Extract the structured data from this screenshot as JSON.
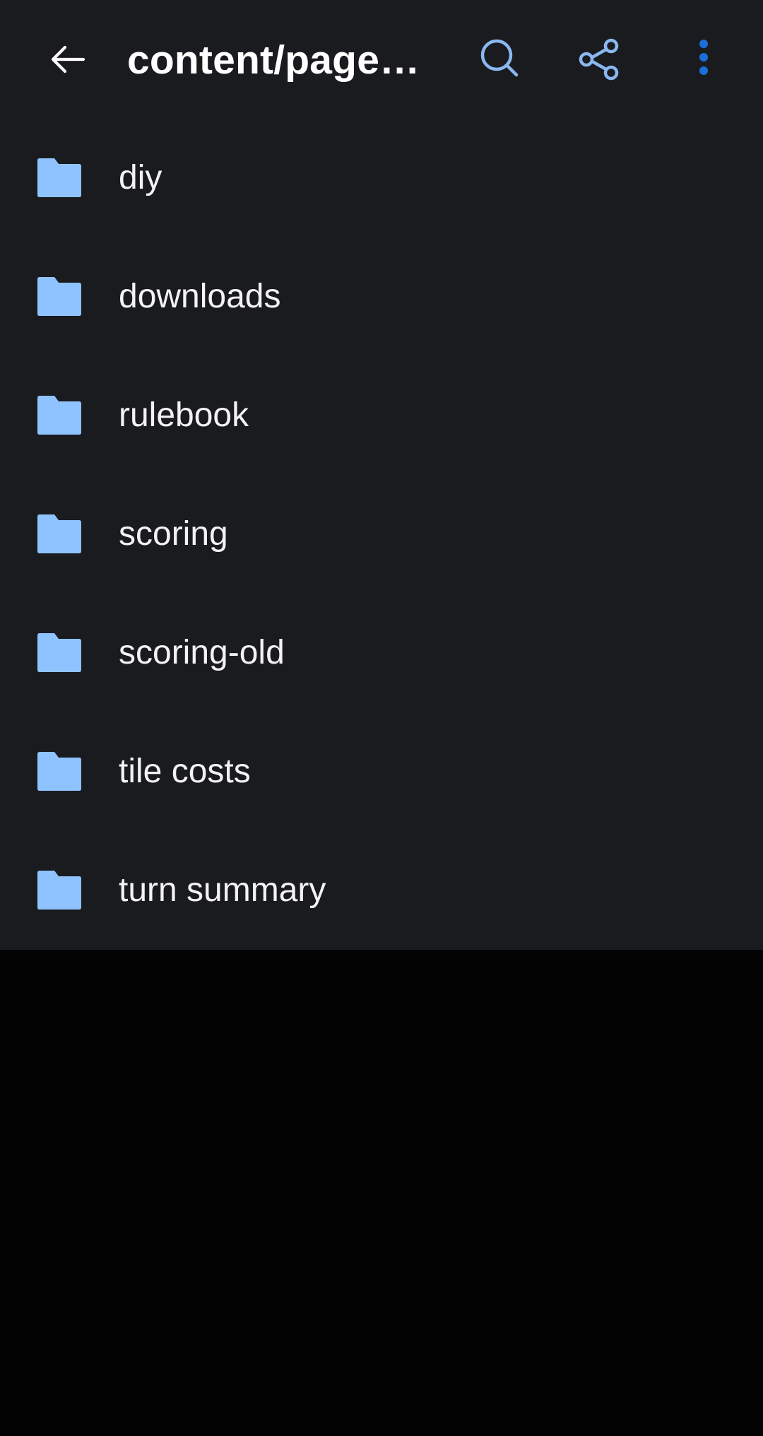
{
  "toolbar": {
    "title": "content/page…",
    "back_icon": "arrow-back-icon",
    "search_icon": "search-icon",
    "share_icon": "share-icon",
    "more_icon": "more-vert-icon"
  },
  "folders": [
    {
      "name": "diy",
      "icon": "folder-icon"
    },
    {
      "name": "downloads",
      "icon": "folder-icon"
    },
    {
      "name": "rulebook",
      "icon": "folder-icon"
    },
    {
      "name": "scoring",
      "icon": "folder-icon"
    },
    {
      "name": "scoring-old",
      "icon": "folder-icon"
    },
    {
      "name": "tile costs",
      "icon": "folder-icon"
    },
    {
      "name": "turn summary",
      "icon": "folder-icon"
    }
  ],
  "colors": {
    "app_background": "#1a1b1f",
    "empty_area": "#030303",
    "folder_icon": "#8fc3ff",
    "action_icon": "#8ab8f0",
    "more_icon": "#1a6fd8",
    "text": "#f3f3f5"
  }
}
